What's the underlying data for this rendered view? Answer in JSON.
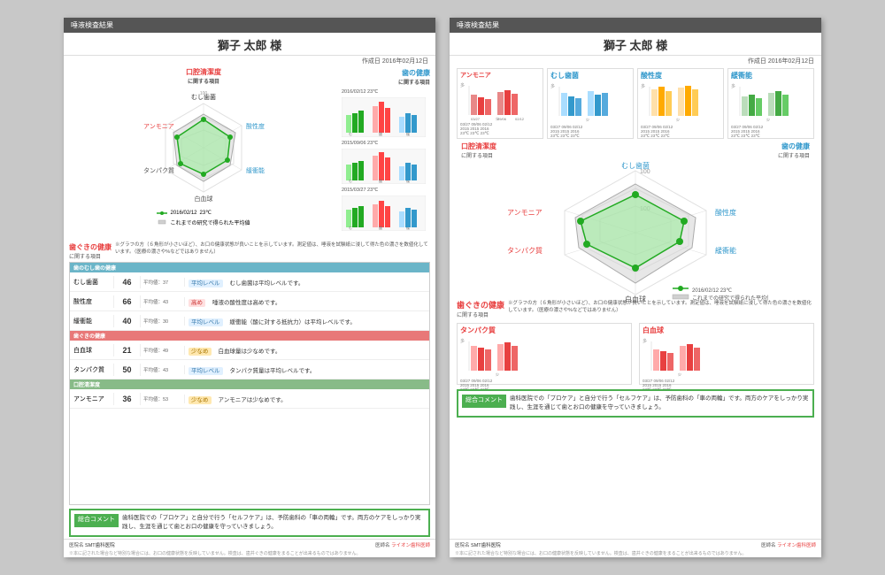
{
  "header_title": "唾液検査結果",
  "patient_name": "獅子 太郎 様",
  "creation_date": "作成日 2016年02月12日",
  "sections": {
    "oral_cleanliness": "口腔清潔度",
    "oral_cleanliness_sub": "に関する項目",
    "teeth_health": "歯の健康",
    "teeth_health_sub": "に関する項目",
    "gum_health": "歯ぐきの健康",
    "gum_health_sub": "に関する項目"
  },
  "radar_labels": {
    "ammonia": "アンモニア",
    "protein": "タンパク質",
    "white_blood": "白血球",
    "acid_resistance": "緩衝能",
    "acidity": "酸性度",
    "cavity": "むし歯菌"
  },
  "legend": {
    "date1": "2016/02/12",
    "temp1": "23℃",
    "label2": "これまでの研究で得られた平均値"
  },
  "results": [
    {
      "group": "歯のむし歯の健康",
      "name": "むし歯菌",
      "value": "46",
      "avg_label": "平均値：37",
      "level": "平均レベル",
      "level_class": "level-normal",
      "comment": "むし歯菌は平均レベルです。"
    },
    {
      "group": "",
      "name": "酸性度",
      "value": "66",
      "avg_label": "平均値：43",
      "level": "高め",
      "level_class": "level-high",
      "comment": "唾液の酸性度は高めです。"
    },
    {
      "group": "",
      "name": "緩衝能",
      "value": "40",
      "avg_label": "平均値：30",
      "level": "平均レベル",
      "level_class": "level-normal",
      "comment": "緩衝能（酸に対する抵抗力）は平均レベルです。"
    },
    {
      "group": "歯ぐきの健康",
      "name": "白血球",
      "value": "21",
      "avg_label": "平均値：49",
      "level": "少なめ",
      "level_class": "level-low",
      "comment": "白血球量は少なめです。"
    },
    {
      "group": "",
      "name": "タンパク質",
      "value": "50",
      "avg_label": "平均値：43",
      "level": "平均レベル",
      "level_class": "level-normal",
      "comment": "タンパク質量は平均レベルです。"
    },
    {
      "group": "口腔清潔度",
      "name": "アンモニア",
      "value": "36",
      "avg_label": "平均値：53",
      "level": "少なめ",
      "level_class": "level-low",
      "comment": "アンモニアは少なめです。"
    }
  ],
  "summary": {
    "label": "総合コメント",
    "text": "歯科医院での「プロケア」と自分で行う「セルフケア」は、予防歯科の「車の両輪」です。両方のケアをしっかり実践し、生涯を通じて歯とお口の健康を守っていきましょう。"
  },
  "footer": {
    "clinic_label": "医院名",
    "clinic_name": "SMT歯科医院",
    "doctor_label": "医師名",
    "doctor_name": "ライオン歯科医師"
  },
  "disclaimer": "※本に記された場合など特別な場合には、お口の健康状態を反映していません。検査は、歯并ぐきの健康をまることが出来るものではありません。",
  "mini_charts": {
    "dates": [
      "03/27",
      "09/06",
      "02/12"
    ],
    "years": [
      "2015",
      "2015",
      "2016"
    ],
    "temps": [
      "23℃",
      "23℃",
      "23℃"
    ],
    "ammonia": [
      30,
      45,
      36
    ],
    "cavity": [
      50,
      40,
      46
    ],
    "acidity": [
      70,
      80,
      66
    ],
    "buffer": [
      35,
      42,
      40
    ],
    "protein": [
      60,
      55,
      50
    ],
    "wbc": [
      35,
      28,
      21
    ]
  }
}
